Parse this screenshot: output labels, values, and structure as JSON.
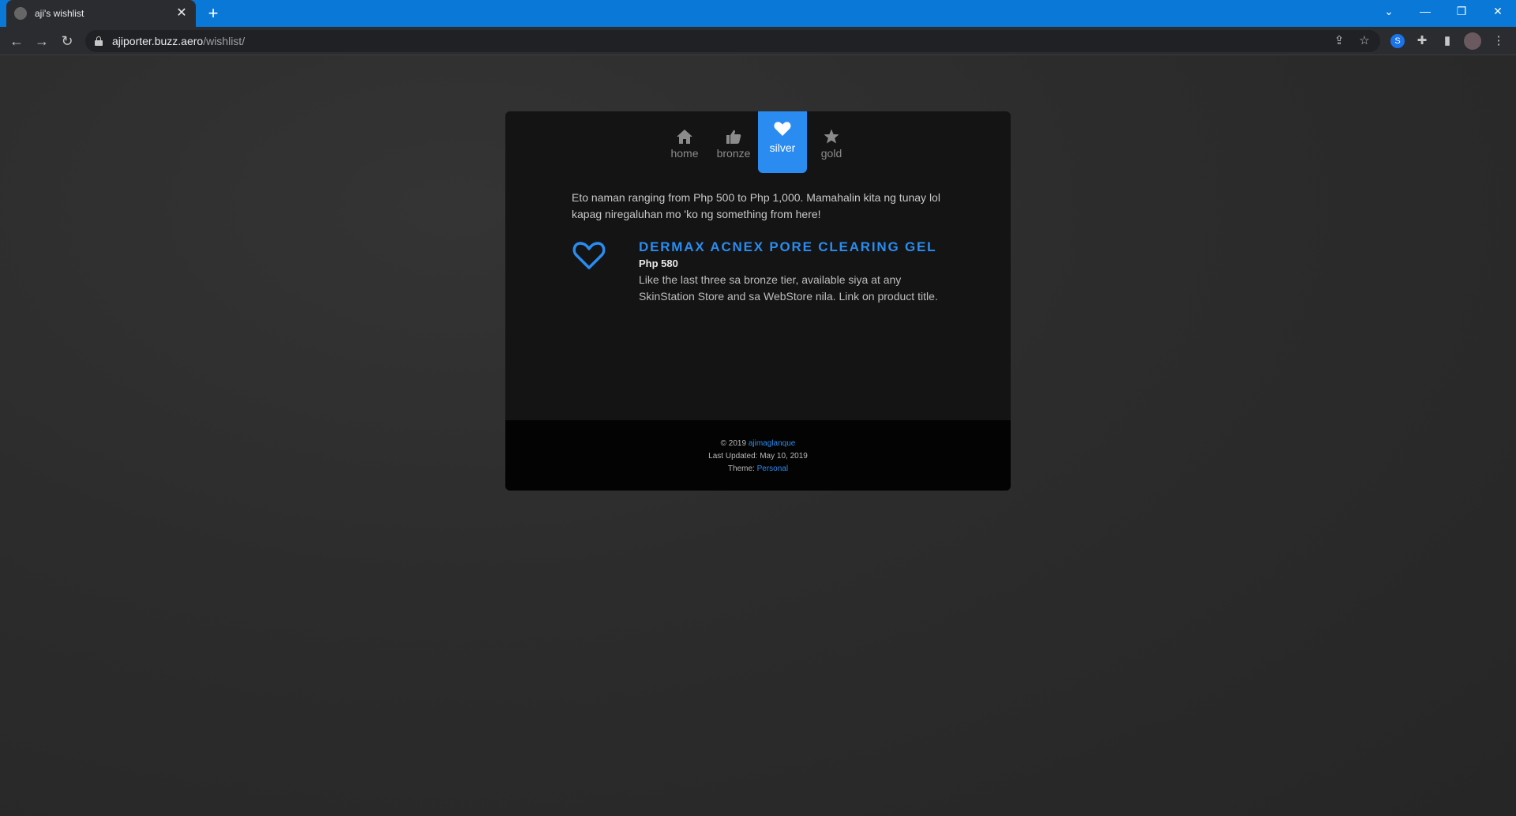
{
  "browser": {
    "tab_title": "aji's wishlist",
    "tab_close": "✕",
    "new_tab": "+",
    "url_host": "ajiporter.buzz.aero",
    "url_path": "/wishlist/",
    "window_controls": [
      "⌄",
      "—",
      "❐",
      "✕"
    ]
  },
  "nav": {
    "items": [
      {
        "label": "home",
        "icon": "home-icon"
      },
      {
        "label": "bronze",
        "icon": "thumbs-up-icon"
      },
      {
        "label": "silver",
        "icon": "heart-icon",
        "active": true
      },
      {
        "label": "gold",
        "icon": "star-icon"
      }
    ]
  },
  "content": {
    "intro": "Eto naman ranging from Php 500 to Php 1,000. Mamahalin kita ng tunay lol kapag niregaluhan mo 'ko ng something from here!",
    "item": {
      "icon": "heart-outline-icon",
      "title": "DERMAX ACNEX PORE CLEARING GEL",
      "price": "Php 580",
      "description": "Like the last three sa bronze tier, available siya at any SkinStation Store and sa WebStore nila. Link on product title."
    }
  },
  "footer": {
    "copyright_prefix": "© 2019",
    "author": "ajimaglanque",
    "last_updated": "Last Updated: May 10, 2019",
    "theme_prefix": "Theme:",
    "theme": "Personal"
  },
  "colors": {
    "accent": "#2a8cf0",
    "card": "#141414",
    "footer": "#030303",
    "titlebar": "#0a78d7"
  }
}
